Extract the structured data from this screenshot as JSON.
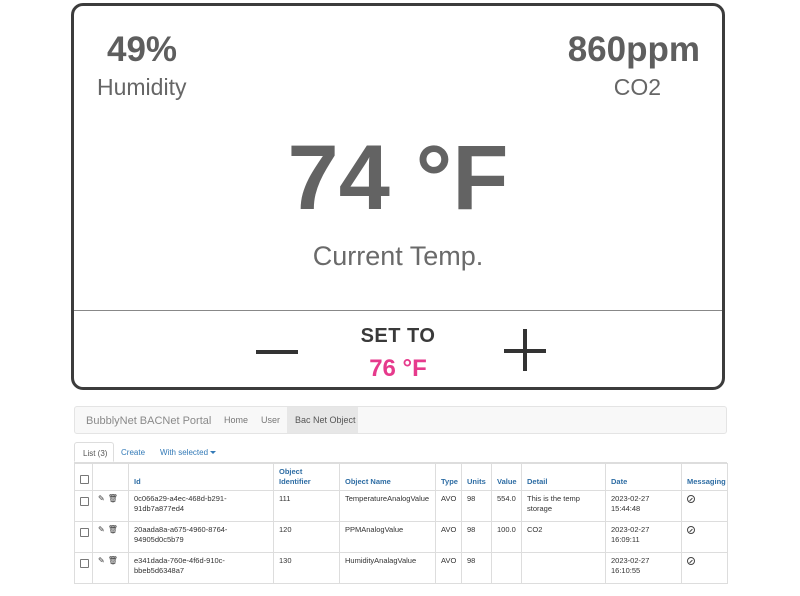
{
  "thermostat": {
    "humidity": {
      "value": "49%",
      "label": "Humidity"
    },
    "co2": {
      "value": "860ppm",
      "label": "CO2"
    },
    "current_temp": {
      "value": "74 °F",
      "label": "Current Temp."
    },
    "set_to": {
      "label": "SET TO",
      "value": "76 °F"
    },
    "accent_color": "#e63a8c"
  },
  "portal": {
    "brand": "BubblyNet BACNet Portal",
    "nav": [
      "Home",
      "User",
      "Bac Net Object"
    ],
    "tabs": {
      "list": "List (3)",
      "create": "Create",
      "with_selected": "With selected"
    },
    "table": {
      "headers": {
        "id": "Id",
        "object_identifier": "Object Identifier",
        "object_name": "Object Name",
        "type": "Type",
        "units": "Units",
        "value": "Value",
        "detail": "Detail",
        "date": "Date",
        "messaging": "Messaging"
      },
      "rows": [
        {
          "id": "0c066a29-a4ec-468d-b291-91db7a877ed4",
          "object_identifier": "111",
          "object_name": "TemperatureAnalogValue",
          "type": "AVO",
          "units": "98",
          "value": "554.0",
          "detail": "This is the temp storage",
          "date": "2023-02-27 15:44:48"
        },
        {
          "id": "20aada8a-a675-4960-8764-94905d0c5b79",
          "object_identifier": "120",
          "object_name": "PPMAnalogValue",
          "type": "AVO",
          "units": "98",
          "value": "100.0",
          "detail": "CO2",
          "date": "2023-02-27 16:09:11"
        },
        {
          "id": "e341dada-760e-4f6d-910c-bbeb5d6348a7",
          "object_identifier": "130",
          "object_name": "HumidityAnalagValue",
          "type": "AVO",
          "units": "98",
          "value": "",
          "detail": "",
          "date": "2023-02-27 16:10:55"
        }
      ]
    }
  }
}
